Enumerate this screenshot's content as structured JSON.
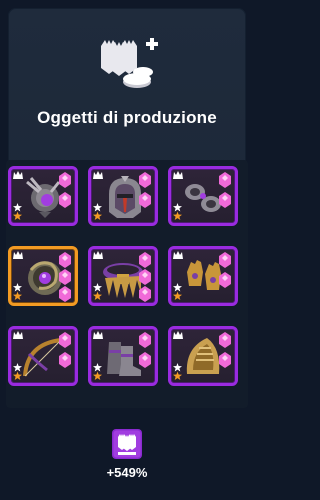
{
  "title": "Oggetti di produzione",
  "bonus_value": "+549%",
  "colors": {
    "frame_purple": "#9a2be0",
    "frame_orange": "#f39b23",
    "panel_bg": "#1f2b3c",
    "page_bg": "#0f1828",
    "gem_pink": "#f06ad8"
  },
  "header_icon": "production-items-icon",
  "bonus_icon": "production-bonus-icon",
  "items": [
    {
      "name": "amulet",
      "icon": "amulet-icon",
      "rarity": "epic",
      "highlighted": false
    },
    {
      "name": "helmet",
      "icon": "helmet-icon",
      "rarity": "epic",
      "highlighted": false
    },
    {
      "name": "bracers",
      "icon": "bracers-icon",
      "rarity": "epic",
      "highlighted": false
    },
    {
      "name": "ring",
      "icon": "ring-icon",
      "rarity": "legendary",
      "highlighted": true
    },
    {
      "name": "belt",
      "icon": "belt-icon",
      "rarity": "epic",
      "highlighted": false
    },
    {
      "name": "gloves",
      "icon": "gloves-icon",
      "rarity": "epic",
      "highlighted": false
    },
    {
      "name": "bow",
      "icon": "bow-icon",
      "rarity": "epic",
      "highlighted": false
    },
    {
      "name": "boots",
      "icon": "boots-icon",
      "rarity": "epic",
      "highlighted": false
    },
    {
      "name": "shoulder-armor",
      "icon": "shoulder-armor-icon",
      "rarity": "epic",
      "highlighted": false
    }
  ]
}
